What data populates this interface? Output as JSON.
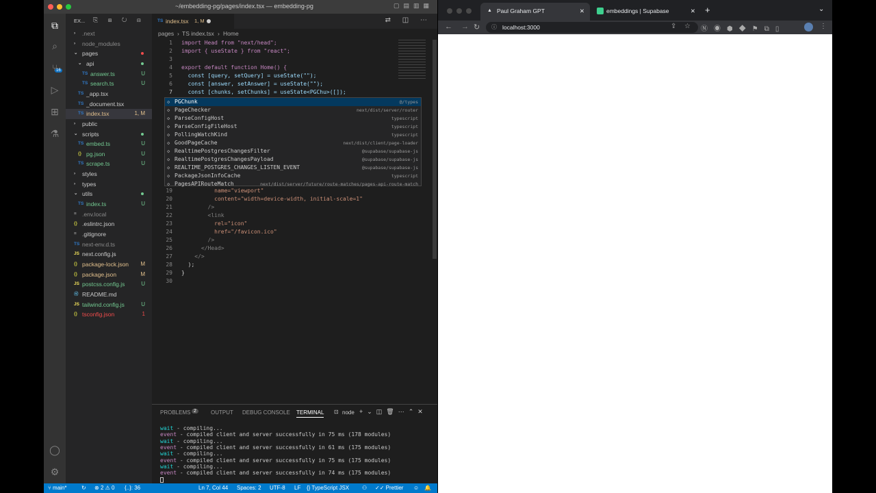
{
  "vscode": {
    "title": "~/embedding-pg/pages/index.tsx — embedding-pg",
    "explorer_label": "EX...",
    "activity_badge": "16",
    "tree": [
      {
        "name": ".next",
        "type": "folder",
        "status": ""
      },
      {
        "name": "node_modules",
        "type": "folder",
        "status": ""
      },
      {
        "name": "pages",
        "type": "folder-open",
        "status": ""
      },
      {
        "name": "api",
        "type": "folder-open",
        "status": ""
      },
      {
        "name": "answer.ts",
        "type": "ts",
        "status": "U"
      },
      {
        "name": "search.ts",
        "type": "ts",
        "status": "U"
      },
      {
        "name": "_app.tsx",
        "type": "ts",
        "status": ""
      },
      {
        "name": "_document.tsx",
        "type": "ts",
        "status": ""
      },
      {
        "name": "index.tsx",
        "type": "ts",
        "status": "1, M"
      },
      {
        "name": "public",
        "type": "folder",
        "status": ""
      },
      {
        "name": "scripts",
        "type": "folder-open",
        "status": ""
      },
      {
        "name": "embed.ts",
        "type": "ts",
        "status": "U"
      },
      {
        "name": "pg.json",
        "type": "json",
        "status": "U"
      },
      {
        "name": "scrape.ts",
        "type": "ts",
        "status": "U"
      },
      {
        "name": "styles",
        "type": "folder",
        "status": ""
      },
      {
        "name": "types",
        "type": "folder",
        "status": ""
      },
      {
        "name": "utils",
        "type": "folder-open",
        "status": ""
      },
      {
        "name": "index.ts",
        "type": "ts",
        "status": "U"
      },
      {
        "name": ".env.local",
        "type": "file",
        "status": ""
      },
      {
        "name": ".eslintrc.json",
        "type": "json",
        "status": ""
      },
      {
        "name": ".gitignore",
        "type": "file",
        "status": ""
      },
      {
        "name": "next-env.d.ts",
        "type": "ts",
        "status": ""
      },
      {
        "name": "next.config.js",
        "type": "js",
        "status": ""
      },
      {
        "name": "package-lock.json",
        "type": "json",
        "status": "M"
      },
      {
        "name": "package.json",
        "type": "json",
        "status": "M"
      },
      {
        "name": "postcss.config.js",
        "type": "js",
        "status": "U"
      },
      {
        "name": "README.md",
        "type": "md",
        "status": ""
      },
      {
        "name": "tailwind.config.js",
        "type": "js",
        "status": "U"
      },
      {
        "name": "tsconfig.json",
        "type": "json",
        "status": "1"
      }
    ],
    "tab": {
      "prefix": "TS",
      "name": "index.tsx",
      "status": "1, M"
    },
    "breadcrumb": [
      "pages",
      "TS index.tsx",
      "Home"
    ],
    "code": [
      {
        "n": "1",
        "text": "import Head from \"next/head\";"
      },
      {
        "n": "2",
        "text": "import { useState } from \"react\";"
      },
      {
        "n": "3",
        "text": ""
      },
      {
        "n": "4",
        "text": "export default function Home() {"
      },
      {
        "n": "5",
        "text": "  const [query, setQuery] = useState(\"\");"
      },
      {
        "n": "6",
        "text": "  const [answer, setAnswer] = useState(\"\");"
      },
      {
        "n": "7",
        "text": "  const [chunks, setChunks] = useState<PGChu>([]);"
      },
      {
        "n": "19",
        "text": "          name=\"viewport\""
      },
      {
        "n": "20",
        "text": "          content=\"width=device-width, initial-scale=1\""
      },
      {
        "n": "21",
        "text": "        />"
      },
      {
        "n": "22",
        "text": "        <link"
      },
      {
        "n": "23",
        "text": "          rel=\"icon\""
      },
      {
        "n": "24",
        "text": "          href=\"/favicon.ico\""
      },
      {
        "n": "25",
        "text": "        />"
      },
      {
        "n": "26",
        "text": "      </Head>"
      },
      {
        "n": "27",
        "text": "    </>"
      },
      {
        "n": "28",
        "text": "  );"
      },
      {
        "n": "29",
        "text": "}"
      },
      {
        "n": "30",
        "text": ""
      }
    ],
    "suggestions": [
      {
        "label": "PGChunk",
        "detail": "@/types"
      },
      {
        "label": "PageChecker",
        "detail": "next/dist/server/router"
      },
      {
        "label": "ParseConfigHost",
        "detail": "typescript"
      },
      {
        "label": "ParseConfigFileHost",
        "detail": "typescript"
      },
      {
        "label": "PollingWatchKind",
        "detail": "typescript"
      },
      {
        "label": "GoodPageCache",
        "detail": "next/dist/client/page-loader"
      },
      {
        "label": "RealtimePostgresChangesFilter",
        "detail": "@supabase/supabase-js"
      },
      {
        "label": "RealtimePostgresChangesPayload",
        "detail": "@supabase/supabase-js"
      },
      {
        "label": "REALTIME_POSTGRES_CHANGES_LISTEN_EVENT",
        "detail": "@supabase/supabase-js"
      },
      {
        "label": "PackageJsonInfoCache",
        "detail": "typescript"
      },
      {
        "label": "PagesAPIRouteMatch",
        "detail": "next/dist/server/future/route-matches/pages-api-route-match"
      }
    ],
    "panel": {
      "tabs": [
        "PROBLEMS",
        "OUTPUT",
        "DEBUG CONSOLE",
        "TERMINAL"
      ],
      "problems_count": "2",
      "terminal_name": "node",
      "lines": [
        {
          "kind": "wait",
          "text": " - compiling..."
        },
        {
          "kind": "event",
          "text": " - compiled client and server successfully in 75 ms (178 modules)"
        },
        {
          "kind": "wait",
          "text": " - compiling..."
        },
        {
          "kind": "event",
          "text": " - compiled client and server successfully in 61 ms (175 modules)"
        },
        {
          "kind": "wait",
          "text": " - compiling..."
        },
        {
          "kind": "event",
          "text": " - compiled client and server successfully in 75 ms (175 modules)"
        },
        {
          "kind": "wait",
          "text": " - compiling..."
        },
        {
          "kind": "event",
          "text": " - compiled client and server successfully in 74 ms (175 modules)"
        }
      ]
    },
    "status": {
      "branch": "main*",
      "errors": "2",
      "warnings": "0",
      "extra": "{..}: 36",
      "position": "Ln 7, Col 44",
      "spaces": "Spaces: 2",
      "encoding": "UTF-8",
      "eol": "LF",
      "language": "TypeScript JSX",
      "prettier": "Prettier"
    }
  },
  "browser": {
    "tabs": [
      {
        "title": "Paul Graham GPT",
        "active": true
      },
      {
        "title": "embeddings | Supabase",
        "active": false
      }
    ],
    "url": "localhost:3000"
  },
  "colors": {
    "statusbar": "#007acc",
    "keyword": "#c586c0",
    "string": "#ce9178",
    "function": "#dcdcaa",
    "variable": "#9cdcfe",
    "ts_icon": "#3178c6",
    "json_icon": "#cbcb41",
    "js_icon": "#f1e05a",
    "untracked": "#73c991",
    "modified": "#e2c08d",
    "error": "#f14c4c"
  }
}
